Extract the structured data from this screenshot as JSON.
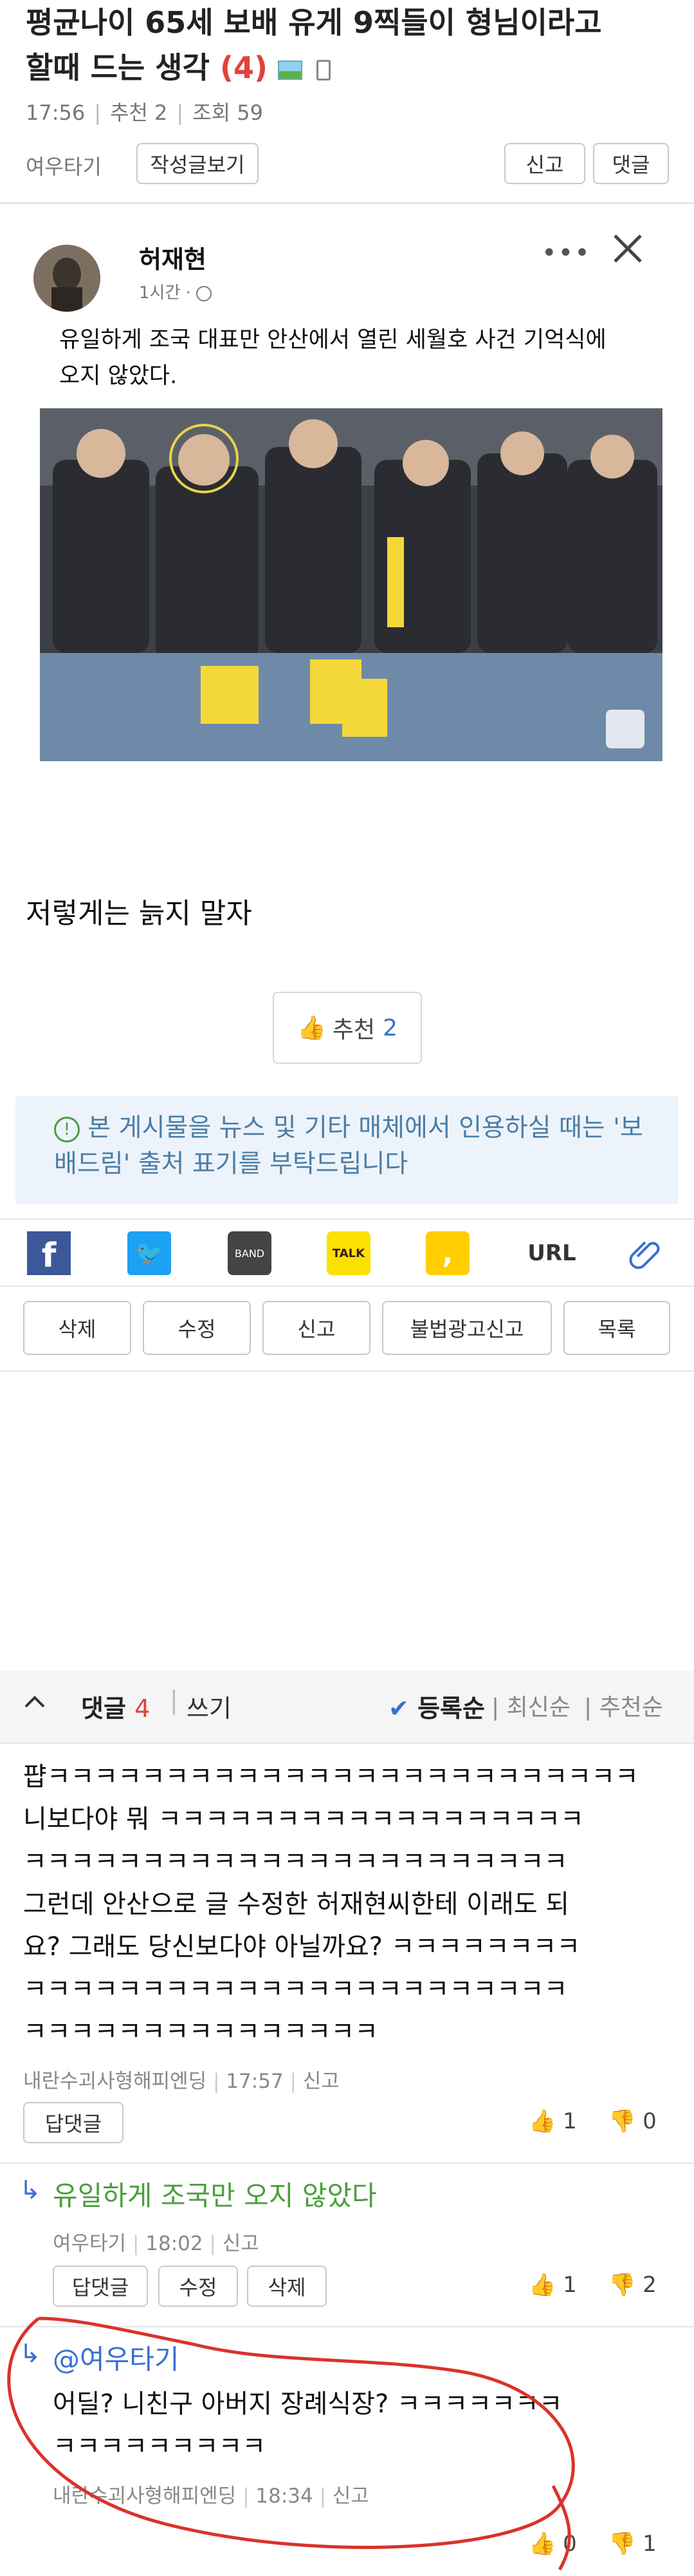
{
  "post": {
    "title_line1": "평균나이 65세 보배 유게 9찍들이 형님이라고",
    "title_line2": "할때 드는 생각",
    "comment_count_badge": "(4)",
    "time": "17:56",
    "recommend": "추천 2",
    "views": "조회 59",
    "author": "여우타기",
    "author_posts_button": "작성글보기",
    "report_button": "신고",
    "comment_button": "댓글"
  },
  "fb_card": {
    "name": "허재현",
    "time": "1시간 ·",
    "text": "유일하게 조국 대표만 안산에서 열린 세월호 사건 기억식에 오지 않았다."
  },
  "body_text": "저렇게는 늙지 말자",
  "recommend_button": {
    "label": "추천",
    "count": "2"
  },
  "notice": "본 게시물을 뉴스 및 기타 매체에서 인용하실 때는 '보배드림' 출처 표기를 부탁드립니다",
  "share": {
    "url_label": "URL"
  },
  "actions": [
    "삭제",
    "수정",
    "신고",
    "불법광고신고",
    "목록"
  ],
  "comments_header": {
    "label": "댓글",
    "count": "4",
    "write": "쓰기",
    "sort_registered": "등록순",
    "sort_latest": "최신순",
    "sort_recommended": "추천순"
  },
  "comments": [
    {
      "lines": [
        "퍕ㅋㅋㅋㅋㅋㅋㅋㅋㅋㅋㅋㅋㅋㅋㅋㅋㅋㅋㅋㅋㅋㅋㅋㅋㅋ",
        "니보다야 뭐 ㅋㅋㅋㅋㅋㅋㅋㅋㅋㅋㅋㅋㅋㅋㅋㅋㅋㅋ",
        "ㅋㅋㅋㅋㅋㅋㅋㅋㅋㅋㅋㅋㅋㅋㅋㅋㅋㅋㅋㅋㅋㅋㅋ",
        "그런데 안산으로 글 수정한 허재현씨한테 이래도 되",
        "요? 그래도 당신보다야 아닐까요? ㅋㅋㅋㅋㅋㅋㅋㅋ",
        "ㅋㅋㅋㅋㅋㅋㅋㅋㅋㅋㅋㅋㅋㅋㅋㅋㅋㅋㅋㅋㅋㅋㅋ",
        "ㅋㅋㅋㅋㅋㅋㅋㅋㅋㅋㅋㅋㅋㅋㅋ"
      ],
      "author": "내란수괴사형해피엔딩",
      "time": "17:57",
      "report": "신고",
      "reply_button": "답댓글",
      "up": "1",
      "down": "0"
    },
    {
      "text": "유일하게 조국만 오지 않았다",
      "author": "여우타기",
      "time": "18:02",
      "report": "신고",
      "buttons": [
        "답댓글",
        "수정",
        "삭제"
      ],
      "up": "1",
      "down": "2"
    },
    {
      "mention": "@여우타기",
      "lines": [
        "어딜? 니친구 아버지 장례식장? ㅋㅋㅋㅋㅋㅋㅋ",
        "ㅋㅋㅋㅋㅋㅋㅋㅋㅋ"
      ],
      "author": "내란수괴사형해피엔딩",
      "time": "18:34",
      "report": "신고",
      "up": "0",
      "down": "1"
    }
  ],
  "colors": {
    "accent_red": "#e0423a",
    "link_blue": "#3a6fd0",
    "green": "#4a9e3c",
    "annotation_red": "#d9332b"
  }
}
